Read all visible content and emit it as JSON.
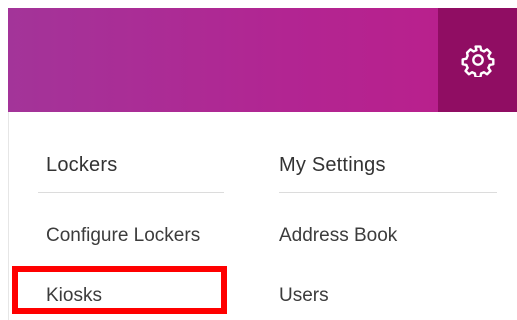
{
  "header": {
    "settings_icon": "gear-icon",
    "colors": {
      "banner_start": "#a33499",
      "banner_end": "#bc1e8a",
      "settings_box": "#900d63"
    }
  },
  "menu": {
    "lockers": {
      "title": "Lockers",
      "items": [
        "Configure Lockers",
        "Kiosks"
      ]
    },
    "settings": {
      "title": "My Settings",
      "items": [
        "Address Book",
        "Users"
      ]
    }
  },
  "highlight": {
    "target": "Kiosks",
    "color": "#ff0000"
  }
}
